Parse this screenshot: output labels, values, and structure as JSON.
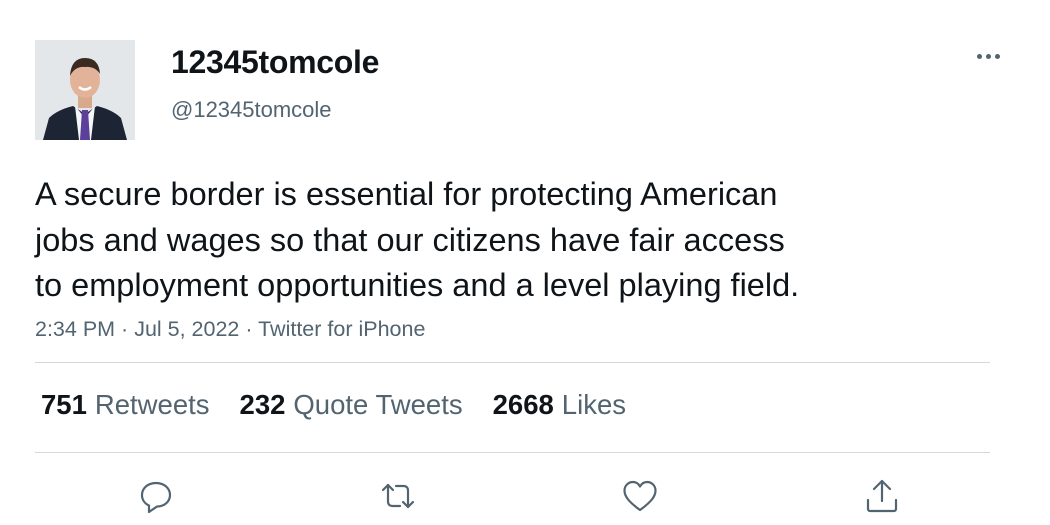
{
  "author": {
    "display_name": "12345tomcole",
    "handle": "@12345tomcole"
  },
  "tweet": {
    "text": "A secure border is essential for protecting American\njobs and wages so that our citizens have fair access\nto employment opportunities and a level playing field.",
    "time": "2:34 PM",
    "date": "Jul 5, 2022",
    "source": "Twitter for iPhone",
    "separator": " · "
  },
  "stats": {
    "retweets": {
      "count": "751",
      "label": "Retweets"
    },
    "quote_tweets": {
      "count": "232",
      "label": "Quote Tweets"
    },
    "likes": {
      "count": "2668",
      "label": "Likes"
    }
  },
  "actions": {
    "icons": [
      "reply-icon",
      "retweet-icon",
      "like-icon",
      "share-icon"
    ]
  },
  "colors": {
    "text": "#0f1419",
    "secondary": "#536471",
    "divider": "#cfd9de"
  }
}
